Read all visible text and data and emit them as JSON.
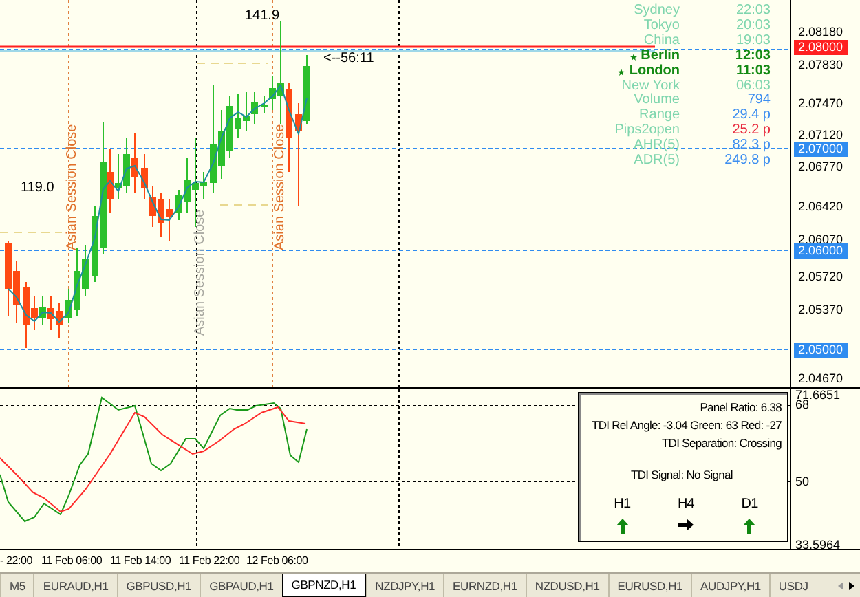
{
  "chart": {
    "annotations": [
      {
        "kind": "label",
        "text": "141.9"
      },
      {
        "kind": "label",
        "text": "119.0"
      },
      {
        "kind": "label",
        "text": "<--56:11"
      }
    ],
    "session_labels": [
      {
        "text": "Asian Session Close",
        "active": true
      },
      {
        "text": "Asian Session Close",
        "active": false
      },
      {
        "text": "Asian Session Close",
        "active": true
      }
    ],
    "info": [
      {
        "name": "Sydney",
        "value": "22:03",
        "active": false,
        "color": "#7fd6ae"
      },
      {
        "name": "Tokyo",
        "value": "20:03",
        "active": false,
        "color": "#7fd6ae"
      },
      {
        "name": "China",
        "value": "19:03",
        "active": false,
        "color": "#7fd6ae"
      },
      {
        "name": "Berlin",
        "value": "12:03",
        "active": true,
        "color": "#138a13"
      },
      {
        "name": "London",
        "value": "11:03",
        "active": true,
        "color": "#138a13"
      },
      {
        "name": "New York",
        "value": "06:03",
        "active": false,
        "color": "#7fd6ae"
      },
      {
        "name": "Volume",
        "value": "794",
        "active": false,
        "color": "#3d8ef0"
      },
      {
        "name": "Range",
        "value": "29.4 p",
        "active": false,
        "color": "#3d8ef0"
      },
      {
        "name": "Pips2open",
        "value": "25.2 p",
        "active": false,
        "color": "#e8283c"
      },
      {
        "name": "AHR(5)",
        "value": "82.3 p",
        "active": false,
        "color": "#3d8ef0"
      },
      {
        "name": "ADR(5)",
        "value": "249.8 p",
        "active": false,
        "color": "#3d8ef0"
      }
    ]
  },
  "price_axis": [
    {
      "text": "2.08180",
      "kind": "tick"
    },
    {
      "text": "2.08000",
      "kind": "marker",
      "color": "#ff2020"
    },
    {
      "text": "2.07830",
      "kind": "tick"
    },
    {
      "text": "2.07470",
      "kind": "tick"
    },
    {
      "text": "2.07120",
      "kind": "tick"
    },
    {
      "text": "2.07000",
      "kind": "marker",
      "color": "#2f8cf0"
    },
    {
      "text": "2.06770",
      "kind": "tick"
    },
    {
      "text": "2.06420",
      "kind": "tick"
    },
    {
      "text": "2.06070",
      "kind": "tick"
    },
    {
      "text": "2.06000",
      "kind": "marker",
      "color": "#2f8cf0"
    },
    {
      "text": "2.05720",
      "kind": "tick"
    },
    {
      "text": "2.05370",
      "kind": "tick"
    },
    {
      "text": "2.05000",
      "kind": "marker",
      "color": "#2f8cf0"
    },
    {
      "text": "2.04670",
      "kind": "tick"
    }
  ],
  "indicator_axis": [
    "71.6651",
    "68",
    "50",
    "33.5964"
  ],
  "tdi_panel": {
    "lines": [
      "Panel Ratio: 6.38",
      "TDI Rel Angle: -3.04 Green: 63 Red: -27",
      "TDI Separation: Crossing"
    ],
    "signal": "TDI Signal: No Signal",
    "timeframes": [
      {
        "label": "H1",
        "kind": "up",
        "color": "#118811"
      },
      {
        "label": "H4",
        "kind": "right",
        "color": "#000000"
      },
      {
        "label": "D1",
        "kind": "up",
        "color": "#118811"
      }
    ]
  },
  "time_axis": [
    "- 22:00",
    "11 Feb 06:00",
    "11 Feb 14:00",
    "11 Feb 22:00",
    "12 Feb 06:00"
  ],
  "tabs": [
    {
      "label": "M5",
      "selected": false
    },
    {
      "label": "EURAUD,H1",
      "selected": false
    },
    {
      "label": "GBPUSD,H1",
      "selected": false
    },
    {
      "label": "GBPAUD,H1",
      "selected": false
    },
    {
      "label": "GBPNZD,H1",
      "selected": true
    },
    {
      "label": "NZDJPY,H1",
      "selected": false
    },
    {
      "label": "EURNZD,H1",
      "selected": false
    },
    {
      "label": "NZDUSD,H1",
      "selected": false
    },
    {
      "label": "EURUSD,H1",
      "selected": false
    },
    {
      "label": "AUDJPY,H1",
      "selected": false
    },
    {
      "label": "USDJ",
      "selected": false
    }
  ]
}
